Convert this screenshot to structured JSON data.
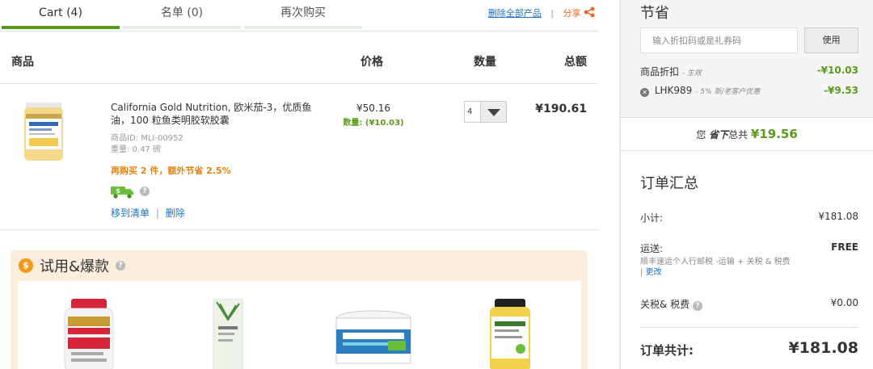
{
  "tabs": [
    {
      "label": "Cart (4)"
    },
    {
      "label": "名单 (0)"
    },
    {
      "label": "再次购买"
    }
  ],
  "tab_actions": {
    "delete_all": "删除全部产品",
    "separator": "|",
    "share": "分享"
  },
  "columns": {
    "product": "商品",
    "price": "价格",
    "quantity": "数量",
    "total": "总额"
  },
  "cart_item": {
    "title": "California Gold Nutrition, 欧米茄-3，优质鱼油，100 粒鱼类明胶软胶囊",
    "product_id": "商品ID: MLI-00952",
    "weight": "重量: 0.47 磅",
    "promo": "再购买 2 件，额外节省 2.5%",
    "move_to_list": "移到清单",
    "link_sep": "|",
    "delete": "删除",
    "price": "¥50.16",
    "qty_discount": "数量: (¥10.03)",
    "quantity": "4",
    "line_total": "¥190.61"
  },
  "trial": {
    "title": "试用&爆款",
    "coin_symbol": "$"
  },
  "savings": {
    "title": "节省",
    "coupon_placeholder": "输入折扣码或是礼券码",
    "apply_label": "使用",
    "product_discount_label": "商品折扣",
    "product_discount_note": "- 生效",
    "product_discount_amount": "-¥10.03",
    "coupon_code": "LHK989",
    "coupon_note": "- 5% 新/老客户优惠",
    "coupon_amount": "-¥9.53"
  },
  "saved_banner": {
    "prefix": "您",
    "emph": "省下",
    "mid": "总共",
    "amount": "¥19.56"
  },
  "summary": {
    "title": "订单汇总",
    "subtotal_label": "小计:",
    "subtotal_value": "¥181.08",
    "shipping_label": "运送:",
    "shipping_value": "FREE",
    "shipping_note": "顺丰速运个人行邮税 -运输 + 关税 & 税费 |",
    "shipping_change": "更改",
    "tax_label": "关税& 税费",
    "tax_value": "¥0.00",
    "grand_label": "订单共计:",
    "grand_value": "¥181.08"
  },
  "colors": {
    "accent_green": "#5c9a1d",
    "promo_orange": "#e8830c",
    "link_blue": "#1a73c8",
    "trial_bg": "#fceedd"
  }
}
